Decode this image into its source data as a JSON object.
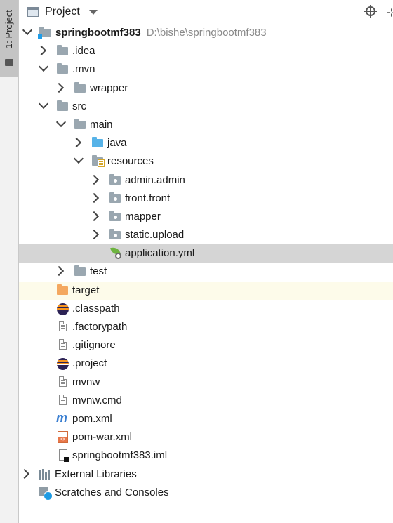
{
  "side_tab": {
    "label": "1: Project"
  },
  "header": {
    "title": "Project"
  },
  "tree": {
    "root": {
      "name": "springbootmf383",
      "path": "D:\\bishe\\springbootmf383"
    },
    "idea": ".idea",
    "mvn": ".mvn",
    "wrapper": "wrapper",
    "src": "src",
    "main": "main",
    "java": "java",
    "resources": "resources",
    "admin": "admin.admin",
    "front": "front.front",
    "mapper": "mapper",
    "static": "static.upload",
    "application": "application.yml",
    "test": "test",
    "target": "target",
    "classpath": ".classpath",
    "factorypath": ".factorypath",
    "gitignore": ".gitignore",
    "project": ".project",
    "mvnw": "mvnw",
    "mvnwcmd": "mvnw.cmd",
    "pom": "pom.xml",
    "pomwar": "pom-war.xml",
    "iml": "springbootmf383.iml",
    "external": "External Libraries",
    "scratches": "Scratches and Consoles"
  },
  "colors": {
    "selected_row": "#d5d5d5",
    "excluded_row": "#fdfbea",
    "accent_folder": "#57b3e8",
    "target_folder": "#f4a860"
  }
}
